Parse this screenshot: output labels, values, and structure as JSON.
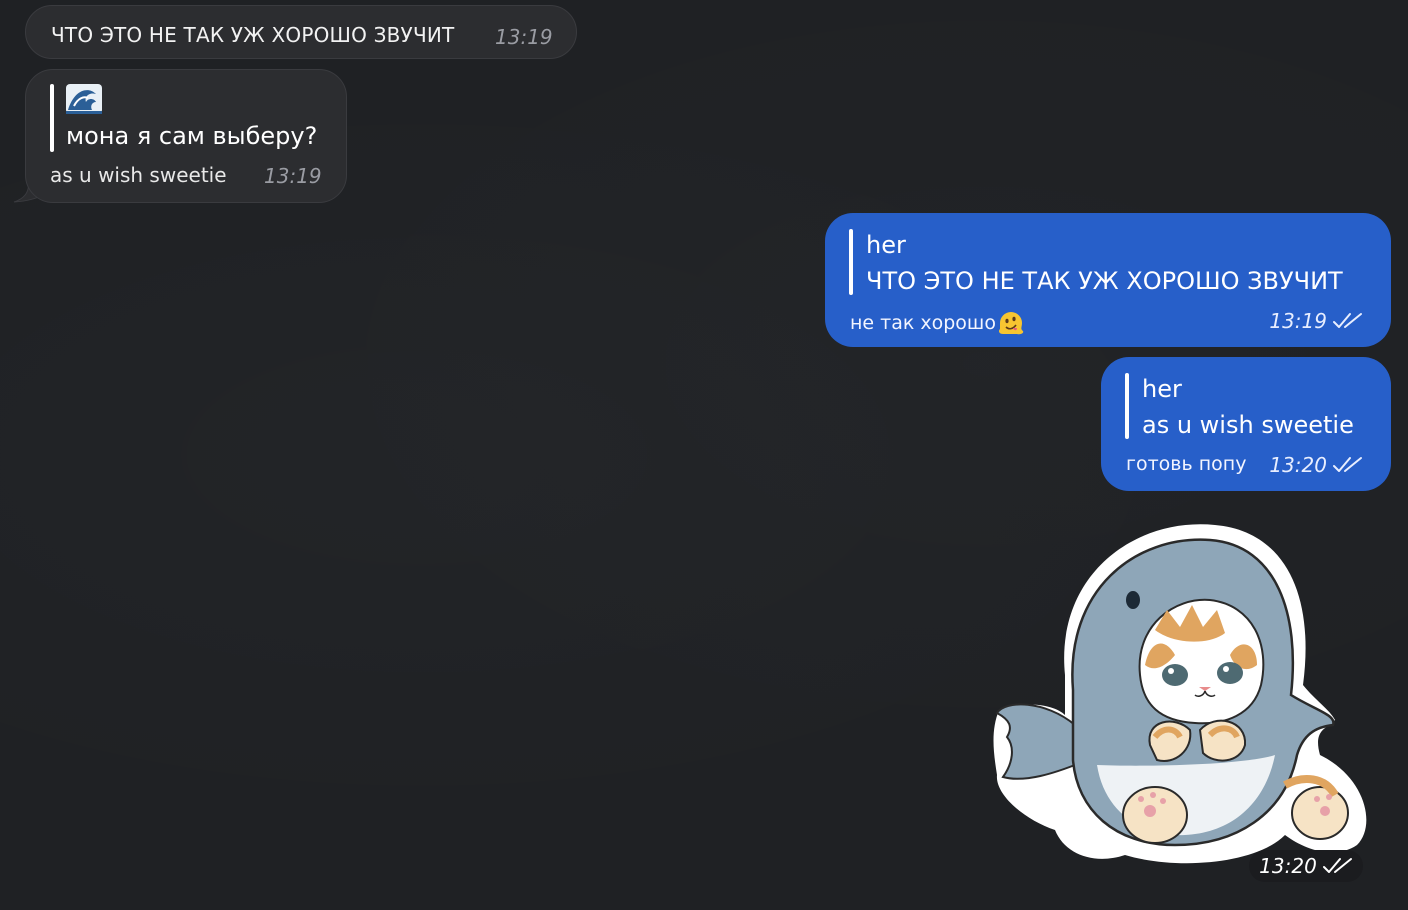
{
  "colors": {
    "background": "#1f2124",
    "incoming_bubble": "#2c2d30",
    "outgoing_bubble": "#275fc9",
    "timestamp_incoming": "#9a9ca3"
  },
  "messages": {
    "incoming_1": {
      "text": "ЧТО ЭТО НЕ ТАК УЖ ХОРОШО ЗВУЧИТ",
      "time": "13:19"
    },
    "incoming_2": {
      "quote_icon": "wave-emoji",
      "quote_text": "мона я сам выберу?",
      "text": "as u wish sweetie",
      "time": "13:19"
    },
    "outgoing_1": {
      "quote_name": "her",
      "quote_text": "ЧТО ЭТО НЕ ТАК УЖ ХОРОШО ЗВУЧИТ",
      "text": "не так хорошо",
      "emoji": "melting-face-emoji",
      "time": "13:19",
      "status_icon": "double-check-icon"
    },
    "outgoing_2": {
      "quote_name": "her",
      "quote_text": "as u wish sweetie",
      "text": "готовь попу",
      "time": "13:20",
      "status_icon": "double-check-icon"
    },
    "outgoing_sticker": {
      "sticker": "cat-in-shark-costume-sticker",
      "time": "13:20",
      "status_icon": "double-check-icon"
    }
  }
}
